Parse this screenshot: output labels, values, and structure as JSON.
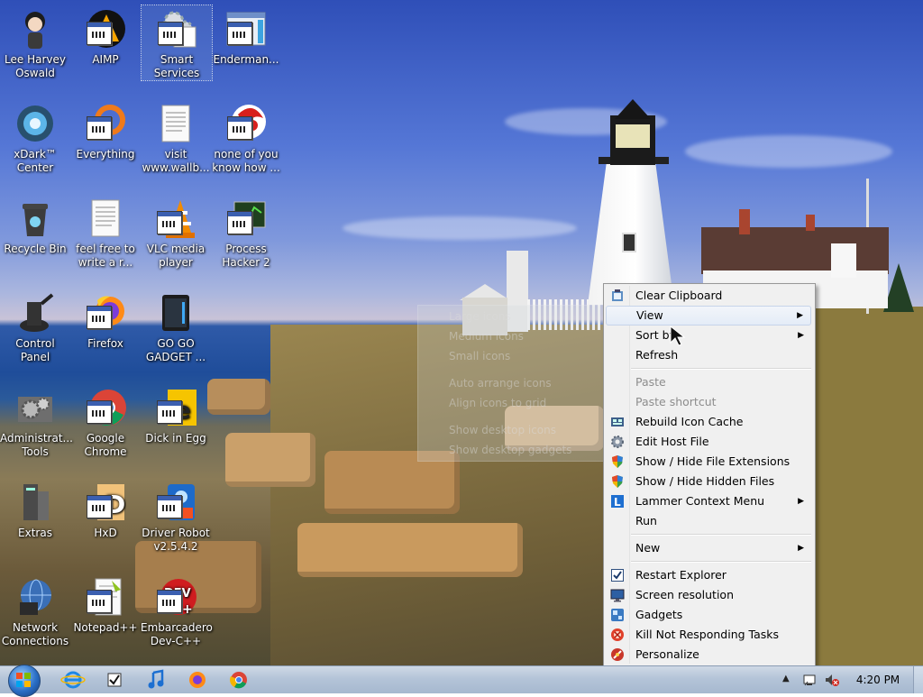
{
  "desktop_icons": [
    {
      "label": "Lee Harvey Oswald",
      "icon": "character-icon"
    },
    {
      "label": "AIMP",
      "icon": "aimp-icon"
    },
    {
      "label": "Smart Services",
      "icon": "gears-icon"
    },
    {
      "label": "Enderman...",
      "icon": "window-icon"
    },
    {
      "label": "xDark™ Center",
      "icon": "xdark-icon"
    },
    {
      "label": "Everything",
      "icon": "search-ring-icon"
    },
    {
      "label": "visit www.wallb...",
      "icon": "text-document-icon"
    },
    {
      "label": "none of you know how ...",
      "icon": "red-logo-icon"
    },
    {
      "label": "Recycle Bin",
      "icon": "recycle-bin-icon"
    },
    {
      "label": "feel free to write a r...",
      "icon": "text-document-icon"
    },
    {
      "label": "VLC media player",
      "icon": "vlc-cone-icon"
    },
    {
      "label": "Process Hacker 2",
      "icon": "process-hacker-icon"
    },
    {
      "label": "Control Panel",
      "icon": "control-panel-icon"
    },
    {
      "label": "Firefox",
      "icon": "firefox-icon"
    },
    {
      "label": "GO GO GADGET ...",
      "icon": "gadget-device-icon"
    },
    {
      "label": "Administrat... Tools",
      "icon": "admin-tools-icon"
    },
    {
      "label": "Google Chrome",
      "icon": "chrome-icon"
    },
    {
      "label": "Dick in Egg",
      "icon": "yellow-app-icon"
    },
    {
      "label": "Extras",
      "icon": "extras-icon"
    },
    {
      "label": "HxD",
      "icon": "hxd-icon"
    },
    {
      "label": "Driver Robot v2.5.4.2",
      "icon": "driver-robot-icon"
    },
    {
      "label": "Network Connections",
      "icon": "network-icon"
    },
    {
      "label": "Notepad++",
      "icon": "notepad-plus-icon"
    },
    {
      "label": "Embarcadero Dev-C++",
      "icon": "dev-cpp-icon"
    }
  ],
  "ghost_menu": [
    "Large icons",
    "Medium icons",
    "Small icons",
    "Auto arrange icons",
    "Align icons to grid",
    "Show desktop icons",
    "Show desktop gadgets"
  ],
  "context_menu": {
    "clear_clipboard": "Clear Clipboard",
    "view": "View",
    "sort_by": "Sort by",
    "refresh": "Refresh",
    "paste": "Paste",
    "paste_shortcut": "Paste shortcut",
    "rebuild_icon_cache": "Rebuild Icon Cache",
    "edit_host_file": "Edit Host File",
    "show_hide_file_extensions": "Show / Hide File Extensions",
    "show_hide_hidden_files": "Show / Hide Hidden Files",
    "lammer_context_menu": "Lammer Context Menu",
    "run": "Run",
    "new": "New",
    "restart_explorer": "Restart Explorer",
    "screen_resolution": "Screen resolution",
    "gadgets": "Gadgets",
    "kill_not_responding": "Kill Not Responding Tasks",
    "personalize": "Personalize",
    "submenu_arrow": "▶"
  },
  "taskbar": {
    "start_label": "Start",
    "pinned": [
      "internet-explorer-icon",
      "tasks-icon",
      "music-note-icon",
      "firefox-icon",
      "chrome-icon"
    ],
    "tray_up": "▲",
    "clock": "4:20 PM"
  },
  "colors": {
    "menu_bg": "#f0f0f0",
    "menu_hover": "#e4ecf7",
    "taskbar": "#b4c4d8"
  }
}
